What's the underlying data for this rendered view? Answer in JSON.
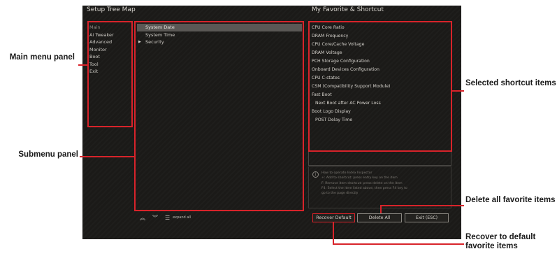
{
  "screen": {
    "left_title": "Setup Tree Map",
    "right_title": "My Favorite & Shortcut"
  },
  "main_menu": {
    "items": [
      {
        "label": "Main",
        "active": true
      },
      {
        "label": "Ai Tweaker"
      },
      {
        "label": "Advanced"
      },
      {
        "label": "Monitor"
      },
      {
        "label": "Boot"
      },
      {
        "label": "Tool"
      },
      {
        "label": "Exit"
      }
    ]
  },
  "submenu": {
    "items": [
      {
        "label": "System Date",
        "selected": true
      },
      {
        "label": "System Time"
      },
      {
        "label": "Security",
        "marker": "▶"
      }
    ]
  },
  "favorites": {
    "items": [
      {
        "label": "CPU Core Ratio"
      },
      {
        "label": "DRAM Frequency"
      },
      {
        "label": "CPU Core/Cache Voltage"
      },
      {
        "label": "DRAM Voltage"
      },
      {
        "label": "PCH Storage Configuration"
      },
      {
        "label": "Onboard Devices Configuration"
      },
      {
        "label": "CPU C-states"
      },
      {
        "label": "CSM (Compatibility Support Module)"
      },
      {
        "label": "Fast Boot"
      },
      {
        "label": "Next Boot after AC Power Loss",
        "sub": true
      },
      {
        "label": "Boot Logo Display"
      },
      {
        "label": "POST Delay Time",
        "sub": true
      }
    ]
  },
  "info": {
    "icon": "info-icon",
    "glyph": "i",
    "lines": [
      "How to operate Index Inspector",
      "+: Add to shortcut: press entry key on the item",
      "F: Remove item shortcut: press delete on the item",
      "F4: Select the item listed above, then press F4 key to",
      "go to the page directly"
    ]
  },
  "toolbar": {
    "up_icon": "double-chevron-up-icon",
    "up_glyph": "︽",
    "down_icon": "double-chevron-down-icon",
    "down_glyph": "︾",
    "expand_icon": "list-icon",
    "expand_glyph": "☰",
    "expand_label": "expand all"
  },
  "buttons": {
    "recover": "Recover Default",
    "delete": "Delete All",
    "exit": "Exit (ESC)"
  },
  "callouts": {
    "main_menu": "Main menu panel",
    "submenu": "Submenu panel",
    "shortcut": "Selected shortcut items",
    "delete_all": "Delete all favorite items",
    "recover": "Recover to default favorite items"
  },
  "colors": {
    "highlight": "#d8232a",
    "screen_bg": "#1b1a18",
    "selected_row": "#5a5855"
  }
}
